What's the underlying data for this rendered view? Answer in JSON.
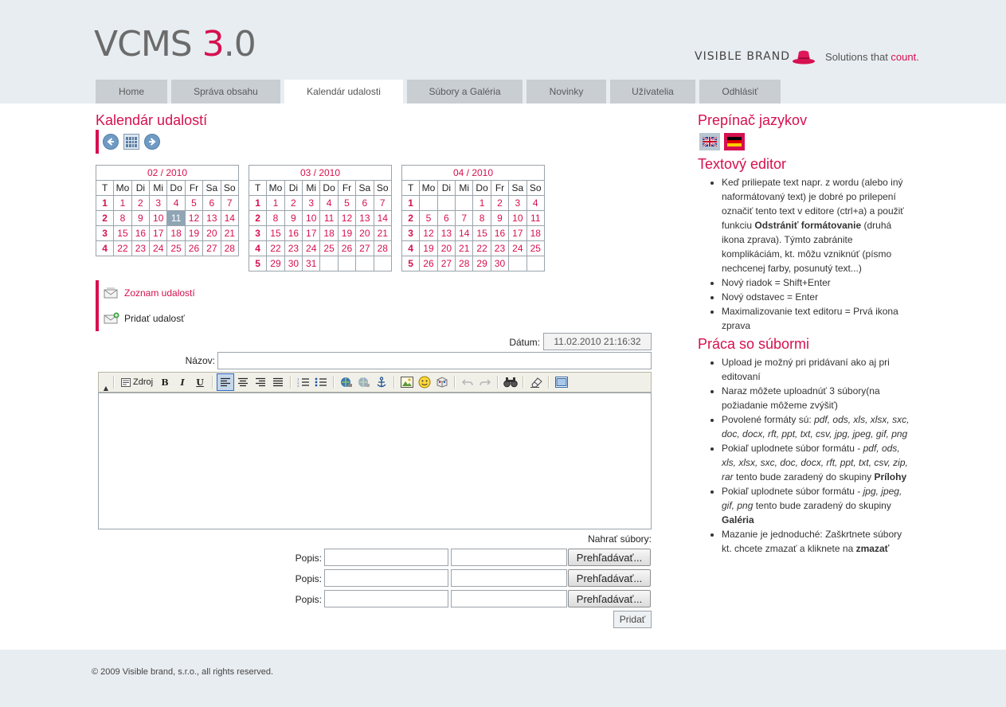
{
  "header": {
    "logo_main": "VCMS ",
    "logo_version": "3",
    "logo_dot": ".",
    "logo_minor": "0",
    "brand_name": "VISIBLE BRAND",
    "slogan_prefix": "Solutions that ",
    "slogan_accent": "count."
  },
  "nav": {
    "tabs": [
      {
        "label": "Home"
      },
      {
        "label": "Správa obsahu"
      },
      {
        "label": "Kalendár udalosti"
      },
      {
        "label": "Súbory a Galéria"
      },
      {
        "label": "Novinky"
      },
      {
        "label": "Užívatelia"
      },
      {
        "label": "Odhlásiť"
      }
    ],
    "active_index": 2
  },
  "calendar": {
    "title": "Kalendár udalostí",
    "prev_icon": "arrow-left-icon",
    "today_icon": "calendar-icon",
    "next_icon": "arrow-right-icon",
    "day_headers": [
      "T",
      "Mo",
      "Di",
      "Mi",
      "Do",
      "Fr",
      "Sa",
      "So"
    ],
    "months": [
      {
        "label": "02 / 2010",
        "weeks": [
          [
            "1",
            "1",
            "2",
            "3",
            "4",
            "5",
            "6",
            "7"
          ],
          [
            "2",
            "8",
            "9",
            "10",
            "11",
            "12",
            "13",
            "14"
          ],
          [
            "3",
            "15",
            "16",
            "17",
            "18",
            "19",
            "20",
            "21"
          ],
          [
            "4",
            "22",
            "23",
            "24",
            "25",
            "26",
            "27",
            "28"
          ]
        ]
      },
      {
        "label": "03 / 2010",
        "weeks": [
          [
            "1",
            "1",
            "2",
            "3",
            "4",
            "5",
            "6",
            "7"
          ],
          [
            "2",
            "8",
            "9",
            "10",
            "11",
            "12",
            "13",
            "14"
          ],
          [
            "3",
            "15",
            "16",
            "17",
            "18",
            "19",
            "20",
            "21"
          ],
          [
            "4",
            "22",
            "23",
            "24",
            "25",
            "26",
            "27",
            "28"
          ],
          [
            "5",
            "29",
            "30",
            "31",
            "",
            "",
            "",
            ""
          ]
        ]
      },
      {
        "label": "04 / 2010",
        "weeks": [
          [
            "1",
            "",
            "",
            "",
            "1",
            "2",
            "3",
            "4"
          ],
          [
            "2",
            "5",
            "6",
            "7",
            "8",
            "9",
            "10",
            "11"
          ],
          [
            "3",
            "12",
            "13",
            "14",
            "15",
            "16",
            "17",
            "18"
          ],
          [
            "4",
            "19",
            "20",
            "21",
            "22",
            "23",
            "24",
            "25"
          ],
          [
            "5",
            "26",
            "27",
            "28",
            "29",
            "30",
            "",
            ""
          ]
        ]
      }
    ],
    "today": {
      "month": 0,
      "week": 1,
      "day": 4
    }
  },
  "side_links": {
    "list_label": "Zoznam udalostí",
    "add_label": "Pridať udalosť"
  },
  "form": {
    "date_label": "Dátum:",
    "date_value": "11.02.2010 21:16:32",
    "name_label": "Názov:",
    "name_value": "",
    "toolbar": {
      "source_label": "Zdroj",
      "bold_label": "B",
      "italic_label": "I",
      "underline_label": "U"
    },
    "upload_label": "Nahrať súbory:",
    "description_label": "Popis:",
    "browse_label": "Prehľadávať...",
    "submit_label": "Pridať"
  },
  "sidebar": {
    "lang_title": "Prepínač jazykov",
    "editor_title": "Textový editor",
    "editor_items": [
      "Keď priliepate text napr. z wordu (alebo iný naformátovaný text) je dobré po prilepení označiť tento text v editore (ctrl+a) a použiť funkciu ",
      "Odstrániť formátovanie",
      " (druhá ikona zprava). Týmto zabránite komplikáciám, kt. môžu vzniknúť (písmo nechcenej farby, posunutý text...)",
      "Nový riadok = Shift+Enter",
      "Nový odstavec = Enter",
      "Maximalizovanie text editoru = Prvá ikona zprava"
    ],
    "files_title": "Práca so súbormi",
    "files_items": {
      "a": "Upload je možný pri pridávaní ako aj pri editovaní",
      "b": "Naraz môžete uploadnúť 3 súbory(na požiadanie môžeme zvýšiť)",
      "c_pre": "Povolené formáty sú: ",
      "c_formats": "pdf, ods, xls, xlsx, sxc, doc, docx, rft, ppt, txt, csv, jpg, jpeg, gif, png",
      "d_pre": "Pokiaľ uplodnete súbor formátu - ",
      "d_formats": "pdf, ods, xls, xlsx, sxc, doc, docx, rft, ppt, txt, csv, zip, rar",
      "d_mid": " tento bude zaradený do skupiny ",
      "d_group": "Prílohy",
      "e_pre": "Pokiaľ uplodnete súbor formátu - ",
      "e_formats": "jpg, jpeg, gif, png",
      "e_mid": " tento bude zaradený do skupiny ",
      "e_group": "Galéria",
      "f_pre": "Mazanie je jednoduché: Zaškrtnete súbory kt. chcete zmazať a kliknete na ",
      "f_strong": "zmazať"
    }
  },
  "footer": {
    "copyright": "© 2009 Visible brand, s.r.o., all rights reserved."
  },
  "colors": {
    "accent": "#d6104f",
    "header_bg": "#e8edf1",
    "tab_bg": "#c9ced3"
  }
}
